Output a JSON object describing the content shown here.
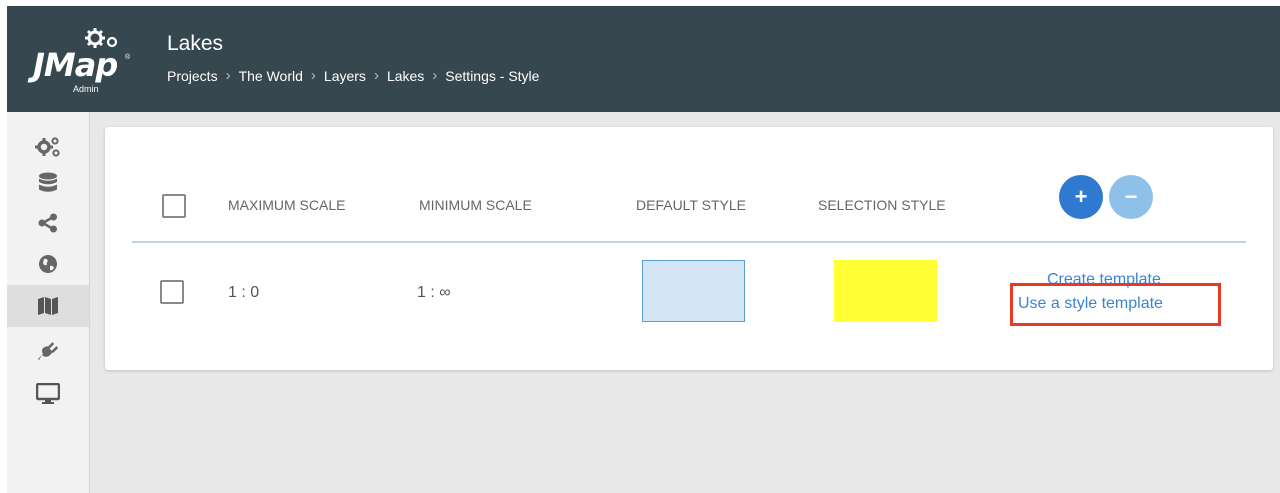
{
  "app": {
    "logo_text": "JMap",
    "logo_reg": "®",
    "logo_sub": "Admin"
  },
  "header": {
    "title": "Lakes",
    "breadcrumb": [
      "Projects",
      "The World",
      "Layers",
      "Lakes",
      "Settings - Style"
    ],
    "separator": "›"
  },
  "sidebar": {
    "items": [
      {
        "icon": "gears-icon"
      },
      {
        "icon": "database-icon"
      },
      {
        "icon": "share-icon"
      },
      {
        "icon": "globe-icon"
      },
      {
        "icon": "map-icon",
        "active": true
      },
      {
        "icon": "plug-icon"
      },
      {
        "icon": "monitor-icon"
      }
    ]
  },
  "table": {
    "headers": {
      "max_scale": "MAXIMUM SCALE",
      "min_scale": "MINIMUM SCALE",
      "default_style": "DEFAULT STYLE",
      "selection_style": "SELECTION STYLE"
    },
    "add_label": "+",
    "remove_label": "−",
    "rows": [
      {
        "max_scale": "1 : 0",
        "min_scale": "1 : ∞",
        "default_style_color": "#d4e6f5",
        "default_style_border": "#5b9fcf",
        "selection_style_color": "#ffff33",
        "links": {
          "create_template": "Create template",
          "use_template": "Use a style template"
        }
      }
    ]
  },
  "colors": {
    "header_bg": "#37474f",
    "accent": "#3d83d3",
    "add_button": "#2f7ad0",
    "remove_button": "#8fc0ea",
    "highlight": "#e53a24"
  }
}
